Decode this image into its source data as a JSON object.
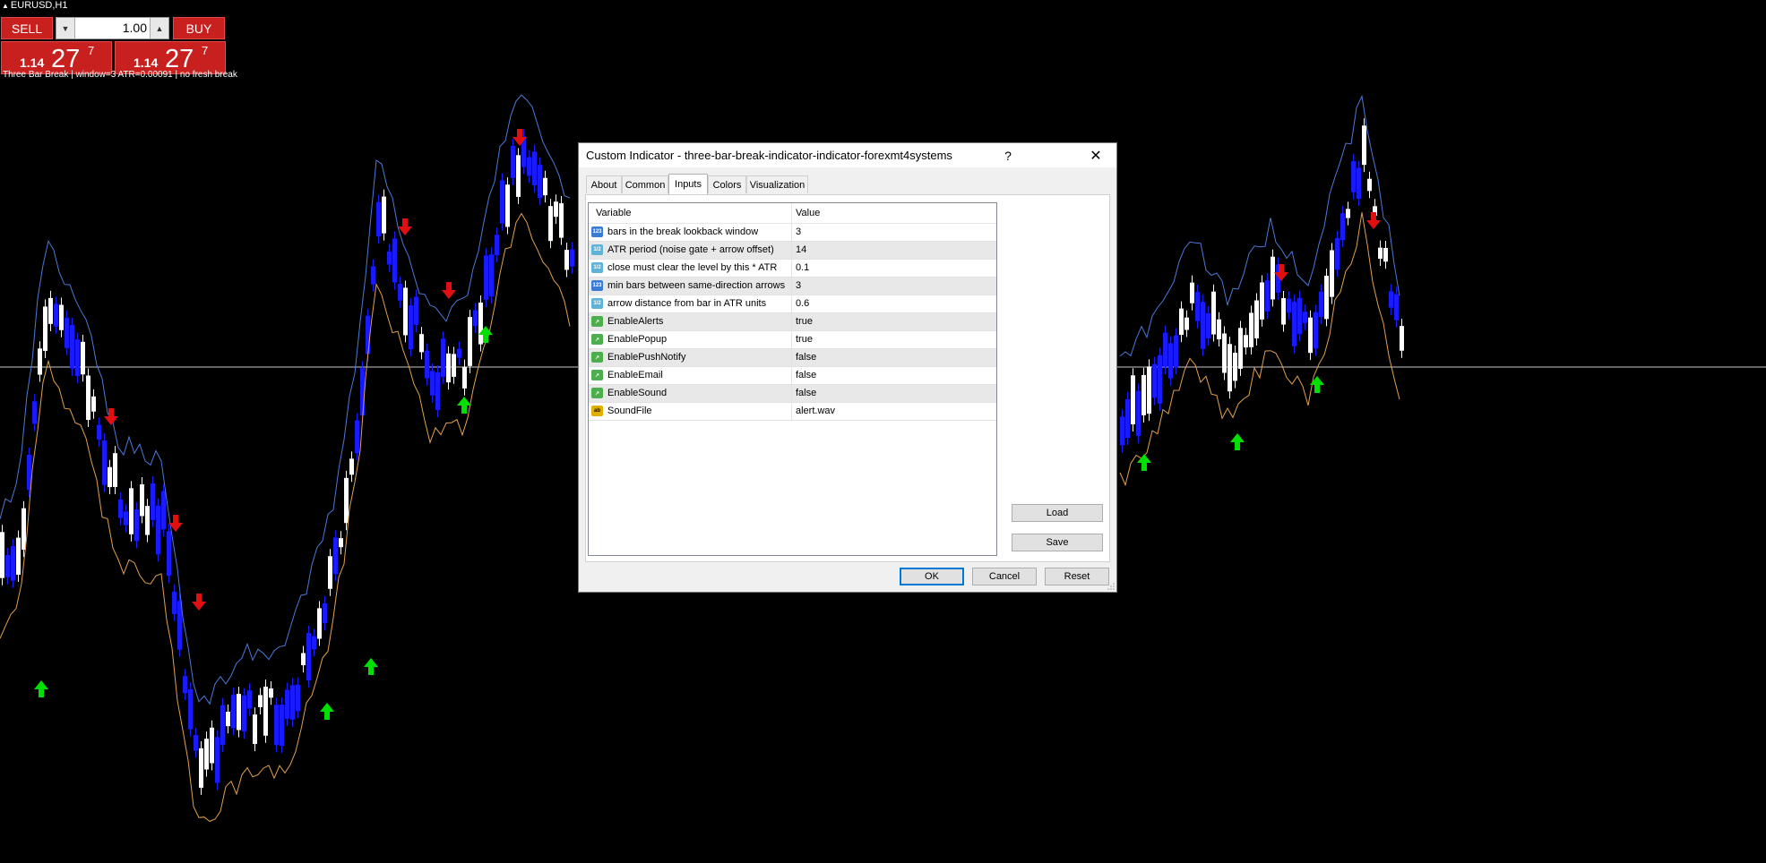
{
  "chart": {
    "symbol": "EURUSD,H1",
    "status_line": "Three Bar Break | window=3 ATR=0.00091 | no fresh break",
    "colors": {
      "background": "#000000",
      "bull_candle": "#1a1aff",
      "bear_candle": "#ffffff",
      "upper_band": "#4d79d8",
      "lower_band": "#e0a050",
      "arrow_up": "#00e000",
      "arrow_down": "#e01010",
      "crosshair": "#c8c8c8"
    }
  },
  "trade_panel": {
    "sell_label": "SELL",
    "buy_label": "BUY",
    "lot_value": "1.00",
    "sell_price": {
      "prefix": "1.14",
      "big": "27",
      "sup": "7"
    },
    "buy_price": {
      "prefix": "1.14",
      "big": "27",
      "sup": "7"
    }
  },
  "dialog": {
    "title": "Custom Indicator - three-bar-break-indicator-indicator-forexmt4systems",
    "help_label": "?",
    "close_label": "✕",
    "tabs": [
      "About",
      "Common",
      "Inputs",
      "Colors",
      "Visualization"
    ],
    "active_tab": "Inputs",
    "grid": {
      "header_variable": "Variable",
      "header_value": "Value",
      "rows": [
        {
          "icon": "123",
          "type": "int",
          "name": "bars in the break lookback window",
          "value": "3"
        },
        {
          "icon": "1/2",
          "type": "dbl",
          "name": "ATR period (noise gate + arrow offset)",
          "value": "14"
        },
        {
          "icon": "1/2",
          "type": "dbl",
          "name": "close must clear the level by this * ATR",
          "value": "0.1"
        },
        {
          "icon": "123",
          "type": "int",
          "name": "min bars between same-direction arrows",
          "value": "3"
        },
        {
          "icon": "1/2",
          "type": "dbl",
          "name": "arrow distance from bar in ATR units",
          "value": "0.6"
        },
        {
          "icon": "↗",
          "type": "bool",
          "name": "EnableAlerts",
          "value": "true"
        },
        {
          "icon": "↗",
          "type": "bool",
          "name": "EnablePopup",
          "value": "true"
        },
        {
          "icon": "↗",
          "type": "bool",
          "name": "EnablePushNotify",
          "value": "false"
        },
        {
          "icon": "↗",
          "type": "bool",
          "name": "EnableEmail",
          "value": "false"
        },
        {
          "icon": "↗",
          "type": "bool",
          "name": "EnableSound",
          "value": "false"
        },
        {
          "icon": "ab",
          "type": "str",
          "name": "SoundFile",
          "value": "alert.wav"
        }
      ]
    },
    "load_label": "Load",
    "save_label": "Save",
    "ok_label": "OK",
    "cancel_label": "Cancel",
    "reset_label": "Reset"
  }
}
